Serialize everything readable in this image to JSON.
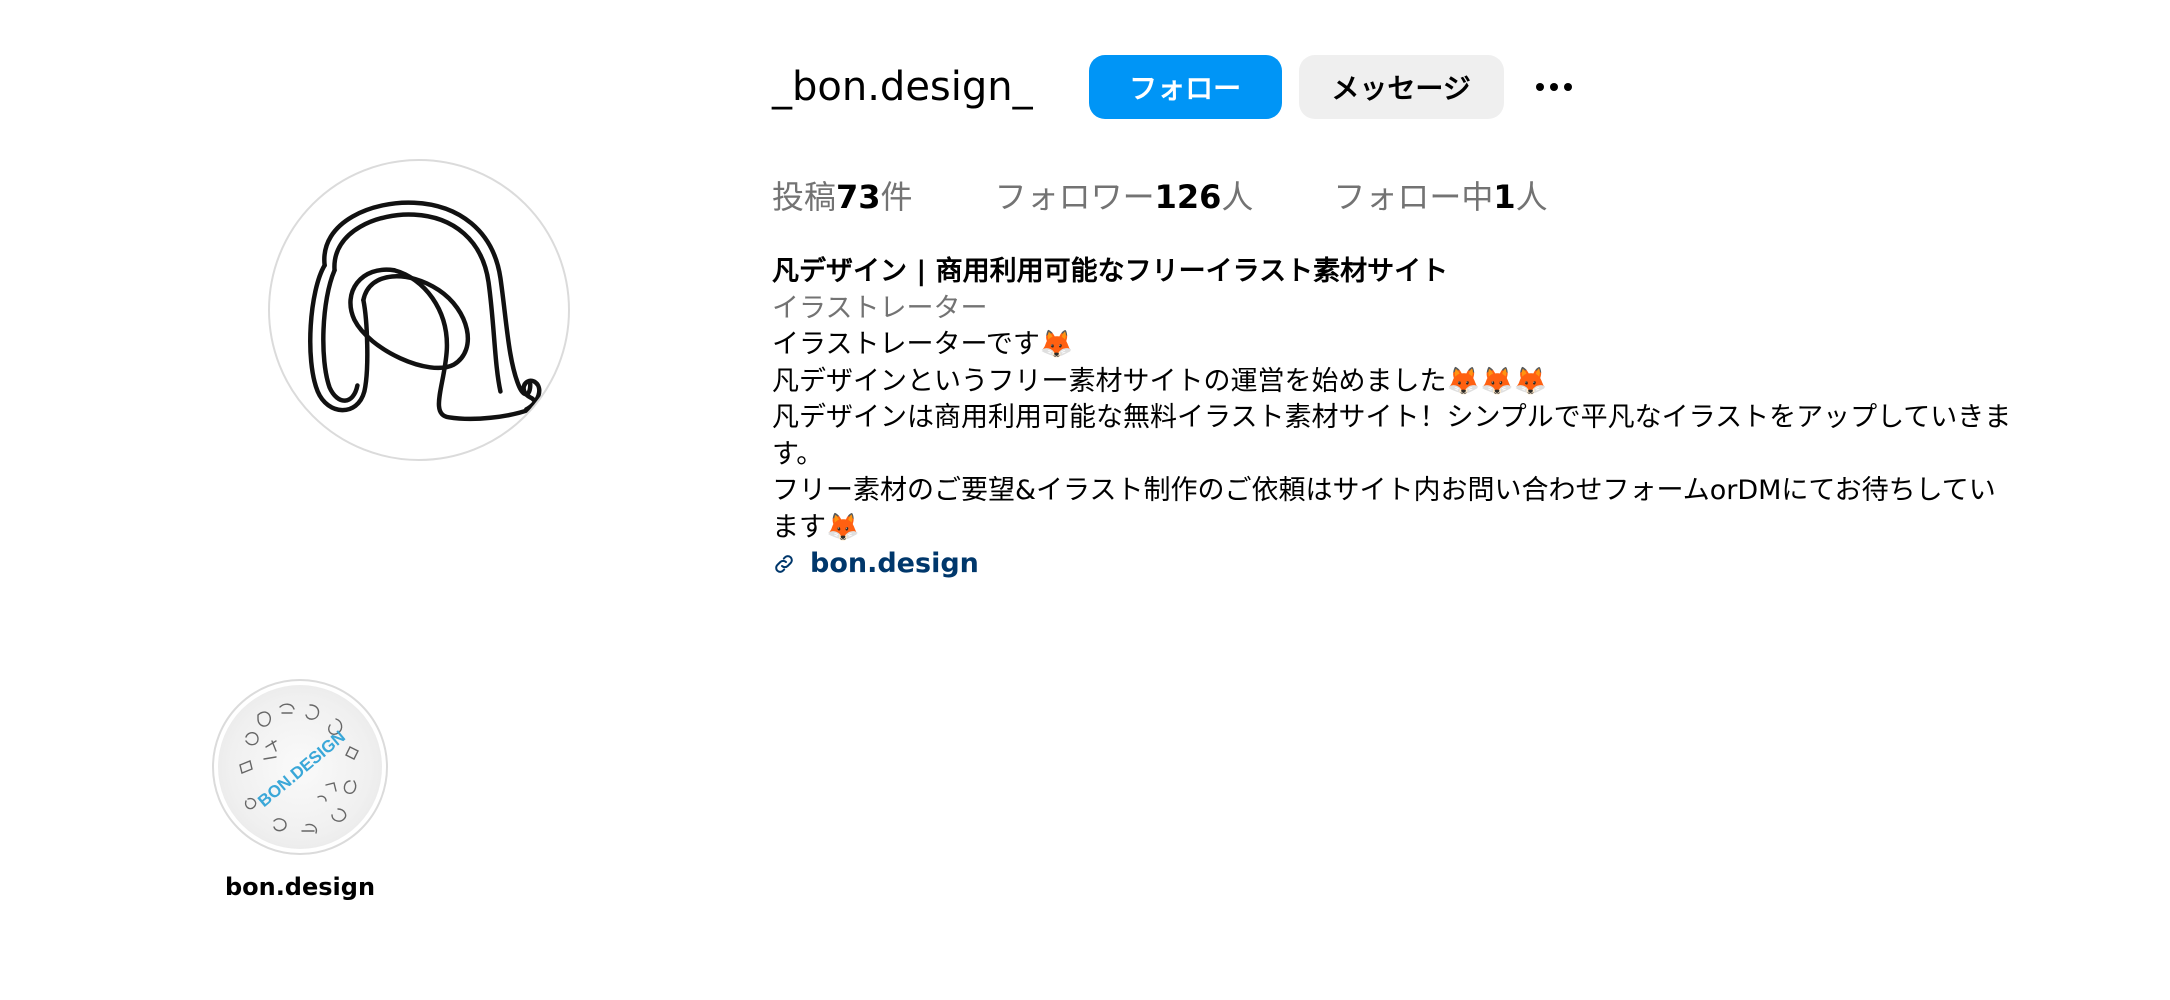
{
  "profile": {
    "username": "_bon.design_",
    "follow_label": "フォロー",
    "message_label": "メッセージ",
    "more_icon": "more-horizontal-icon"
  },
  "stats": {
    "posts_prefix": "投稿",
    "posts_count": "73",
    "posts_suffix": "件",
    "followers_prefix": "フォロワー",
    "followers_count": "126",
    "followers_suffix": "人",
    "following_prefix": "フォロー中",
    "following_count": "1",
    "following_suffix": "人"
  },
  "bio": {
    "name": "凡デザイン | 商用利用可能なフリーイラスト素材サイト",
    "category": "イラストレーター",
    "lines": [
      "イラストレーターです🦊",
      "凡デザインというフリー素材サイトの運営を始めました🦊🦊🦊",
      "凡デザインは商用利用可能な無料イラスト素材サイト！シンプルで平凡なイラストをアップしていきます。",
      "フリー素材のご要望&イラスト制作のご依頼はサイト内お問い合わせフォームorDMにてお待ちしています🦊"
    ],
    "link_text": "bon.design",
    "link_icon": "link-icon"
  },
  "highlights": [
    {
      "label": "bon.design",
      "cover_text": "BON.DESIGN"
    }
  ],
  "colors": {
    "accent": "#0095f6",
    "secondary_button": "#efefef",
    "muted_text": "#737373",
    "link": "#00376b",
    "highlight_text": "#3aa7d8"
  }
}
